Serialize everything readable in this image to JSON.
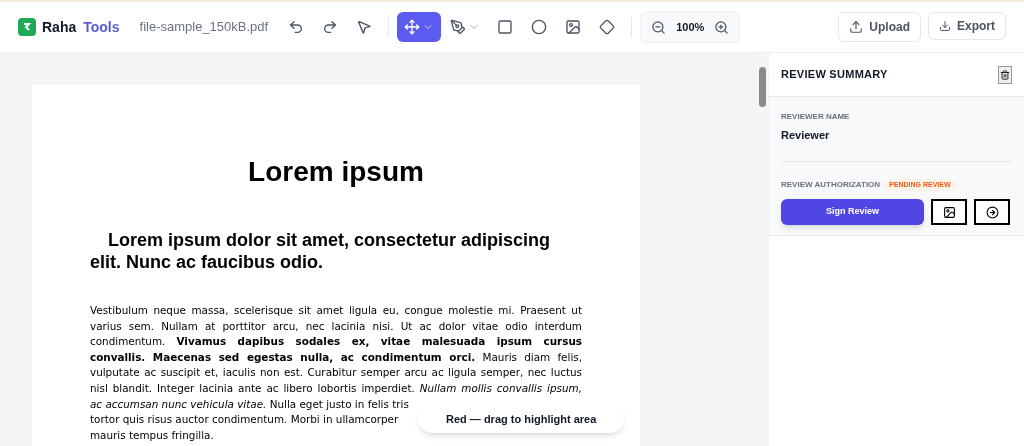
{
  "app": {
    "brand_first": "Raha",
    "brand_second": "Tools",
    "file_name": "file-sample_150kB.pdf"
  },
  "toolbar": {
    "tools": [
      {
        "kind": "undo",
        "selected": false
      },
      {
        "kind": "redo",
        "selected": false
      },
      {
        "kind": "select",
        "selected": false
      },
      {
        "kind": "move",
        "selected": true,
        "dropdown": true
      },
      {
        "kind": "pen",
        "selected": false,
        "dropdown": true
      },
      {
        "kind": "rect",
        "selected": false
      },
      {
        "kind": "circle",
        "selected": false
      },
      {
        "kind": "image",
        "selected": false
      },
      {
        "kind": "stamp",
        "selected": false
      }
    ],
    "zoom": "100%",
    "upload": "Upload",
    "export": "Export"
  },
  "document": {
    "title": "Lorem ipsum",
    "heading": "Lorem ipsum dolor sit amet, consectetur adipiscing elit. Nunc ac faucibus odio.",
    "paragraph_lines": [
      {
        "text": "Vestibulum neque massa, scelerisque sit amet ligula eu, congue molestie mi. Praesent ut",
        "justified": true
      },
      {
        "text": "varius sem. Nullam at porttitor arcu, nec lacinia nisi. Ut ac dolor vitae odio interdum",
        "justified": true
      },
      {
        "text": "condimentum. **Vivamus dapibus sodales ex, vitae malesuada ipsum cursus**",
        "justified": true
      },
      {
        "text": "**convallis. Maecenas sed egestas nulla, ac condimentum orci.** Mauris diam felis,",
        "justified": true
      },
      {
        "text": "vulputate ac suscipit et, iaculis non est. Curabitur semper arcu ac ligula semper, nec luctus",
        "justified": true
      },
      {
        "text": "nisl blandit. Integer lacinia ante ac libero lobortis imperdiet. *Nullam mollis convallis ipsum,*",
        "justified": true
      },
      {
        "text": "*ac accumsan nunc vehicula vitae.* Nulla eget justo in felis tris",
        "justified": false
      },
      {
        "text": "tortor quis risus auctor condimentum. Morbi in ullamcorper",
        "justified": false
      },
      {
        "text": "mauris tempus fringilla.",
        "justified": false
      }
    ]
  },
  "toast": "Red — drag to highlight area",
  "review": {
    "title": "REVIEW SUMMARY",
    "reviewer_label": "REVIEWER NAME",
    "reviewer": "Reviewer",
    "authorization_label": "REVIEW AUTHORIZATION",
    "status": "PENDING REVIEW",
    "sign_button": "Sign Review"
  }
}
